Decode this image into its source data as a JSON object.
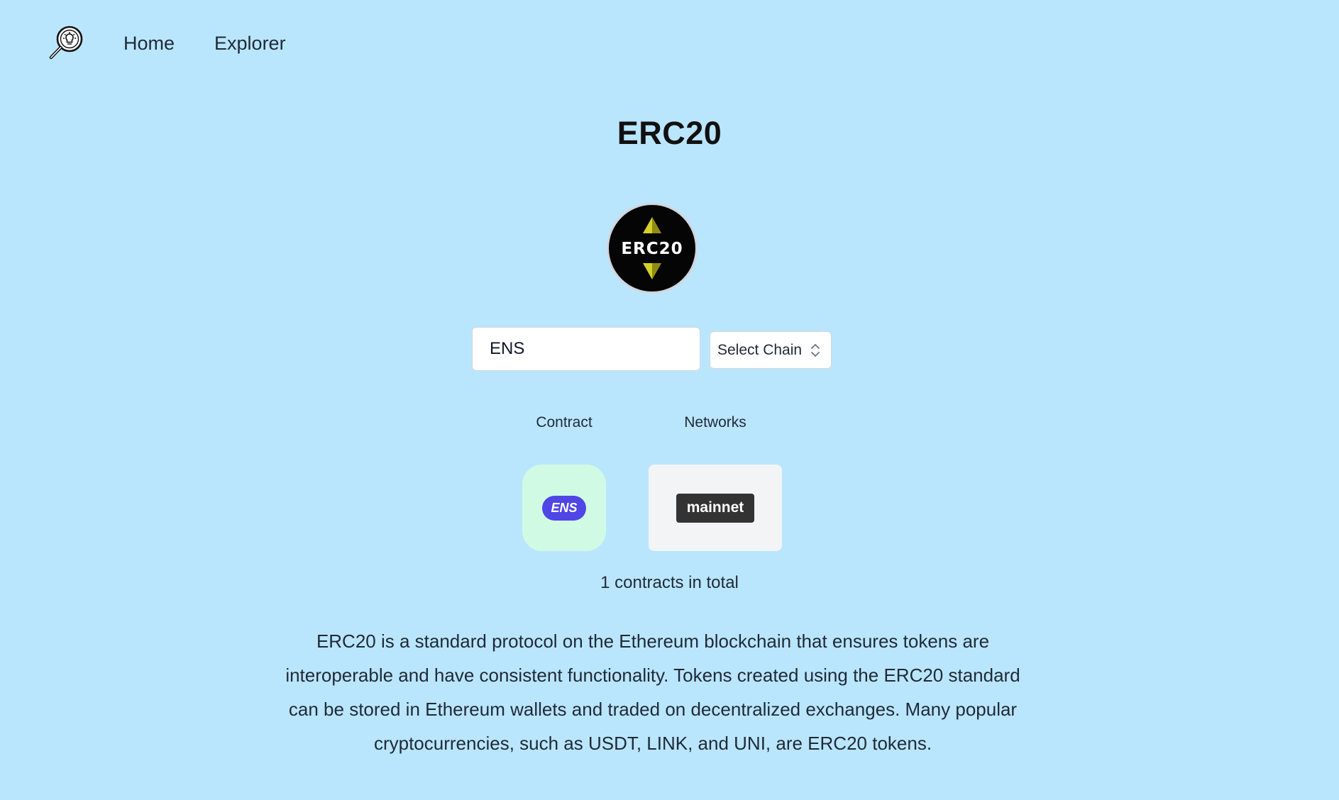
{
  "nav": {
    "logo_icon": "lightbulb-magnifier-logo-icon",
    "links": [
      {
        "label": "Home"
      },
      {
        "label": "Explorer"
      }
    ]
  },
  "page": {
    "title": "ERC20",
    "badge_text": "ERC20",
    "badge_icon": "erc20-token-badge-icon"
  },
  "search": {
    "value": "ENS",
    "chain_select": {
      "selected": "Select Chain",
      "icon": "chevron-up-down-icon"
    }
  },
  "results": {
    "contract_header": "Contract",
    "networks_header": "Networks",
    "contracts": [
      {
        "label": "ENS",
        "color": "#4f46e5"
      }
    ],
    "networks": [
      {
        "label": "mainnet",
        "color": "#333333"
      }
    ],
    "total_text": "1 contracts in total"
  },
  "description": "ERC20 is a standard protocol on the Ethereum blockchain that ensures tokens are interoperable and have consistent functionality. Tokens created using the ERC20 standard can be stored in Ethereum wallets and traded on decentralized exchanges. Many popular cryptocurrencies, such as USDT, LINK, and UNI, are ERC20 tokens.",
  "colors": {
    "background": "#bae6fd",
    "contract_card": "#d1fae5",
    "network_card": "#f3f4f6"
  }
}
